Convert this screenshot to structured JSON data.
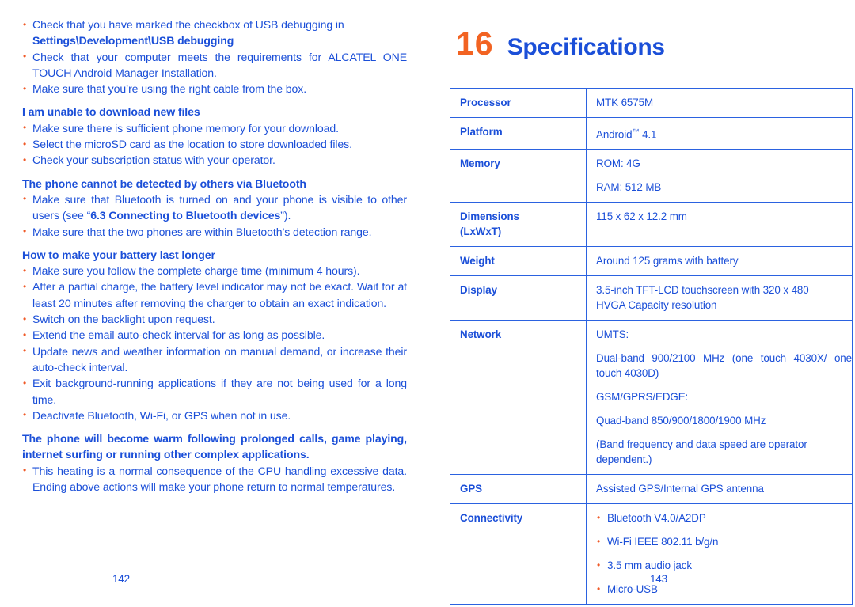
{
  "colors": {
    "text_blue": "#1B4FD8",
    "accent_orange": "#F26322",
    "bullet_orange": "#F05A28",
    "table_border": "#2B62E0"
  },
  "left_page": {
    "folio": "142",
    "blocks": [
      {
        "type": "bullet",
        "text_pre": "Check that you have marked the checkbox of USB debugging in",
        "text_bold": "Settings\\Development\\USB debugging"
      },
      {
        "type": "bullet",
        "text": "Check that your computer meets the requirements for ALCATEL ONE TOUCH Android Manager Installation."
      },
      {
        "type": "bullet",
        "text": "Make sure that you’re using the right cable from the box."
      },
      {
        "type": "heading",
        "text": "I am unable to download new files"
      },
      {
        "type": "bullet",
        "text": "Make sure there is sufficient phone memory for your download."
      },
      {
        "type": "bullet",
        "text": "Select the microSD card as the location to store downloaded files."
      },
      {
        "type": "bullet",
        "text": "Check your subscription status with your operator."
      },
      {
        "type": "heading",
        "text": "The phone cannot be detected by others via Bluetooth"
      },
      {
        "type": "bullet_mixed",
        "part1": "Make sure that Bluetooth is turned on and your phone is visible to other users (see “",
        "part_bold": "6.3 Connecting to Bluetooth devices",
        "part2": "”)."
      },
      {
        "type": "bullet",
        "text": "Make sure that the two phones are within Bluetooth’s detection range."
      },
      {
        "type": "heading",
        "text": "How to make your battery last longer"
      },
      {
        "type": "bullet",
        "text": "Make sure you follow the complete charge time (minimum 4 hours)."
      },
      {
        "type": "bullet",
        "text": "After a partial charge, the battery level indicator may not be exact. Wait for at least 20 minutes after removing the charger to obtain an exact indication."
      },
      {
        "type": "bullet",
        "text": "Switch on the backlight upon request."
      },
      {
        "type": "bullet",
        "text": "Extend the email auto-check interval for as long as possible."
      },
      {
        "type": "bullet",
        "text": "Update news and weather information on manual demand, or increase their auto-check interval."
      },
      {
        "type": "bullet",
        "text": "Exit background-running applications if they are not being used for a long time."
      },
      {
        "type": "bullet",
        "text": "Deactivate Bluetooth, Wi-Fi, or GPS when not in use."
      },
      {
        "type": "heading",
        "text": "The phone will become warm following prolonged calls, game playing, internet surfing or running other complex applications."
      },
      {
        "type": "bullet",
        "text": "This heating is a normal consequence of the CPU handling excessive data. Ending above actions will make your phone return to normal temperatures."
      }
    ]
  },
  "right_page": {
    "folio": "143",
    "chapter_number": "16",
    "chapter_title": "Specifications",
    "spec_table": {
      "rows": [
        {
          "label": "Processor",
          "lines": [
            "MTK 6575M"
          ]
        },
        {
          "label": "Platform",
          "lines": [
            "Android™ 4.1"
          ],
          "has_tm": true,
          "tm_pre": "Android",
          "tm_post": " 4.1"
        },
        {
          "label": "Memory",
          "lines": [
            "ROM: 4G",
            "RAM: 512 MB"
          ]
        },
        {
          "label": "Dimensions",
          "label_sub": "(LxWxT)",
          "lines": [
            "115 x 62 x 12.2 mm"
          ]
        },
        {
          "label": "Weight",
          "lines": [
            "Around 125 grams with battery"
          ]
        },
        {
          "label": "Display",
          "lines_tight": [
            "3.5-inch TFT-LCD touchscreen with 320 x 480",
            "HVGA Capacity resolution"
          ]
        },
        {
          "label": "Network",
          "lines": [
            "UMTS:",
            "Dual-band 900/2100 MHz (one touch 4030X/ one touch 4030D)",
            "GSM/GPRS/EDGE:",
            "Quad-band 850/900/1800/1900 MHz",
            "(Band frequency and data speed are operator dependent.)"
          ]
        },
        {
          "label": "GPS",
          "lines": [
            "Assisted GPS/Internal GPS antenna"
          ]
        },
        {
          "label": "Connectivity",
          "bullets": [
            "Bluetooth V4.0/A2DP",
            "Wi-Fi IEEE 802.11 b/g/n",
            "3.5 mm audio jack",
            "Micro-USB"
          ]
        }
      ]
    }
  }
}
